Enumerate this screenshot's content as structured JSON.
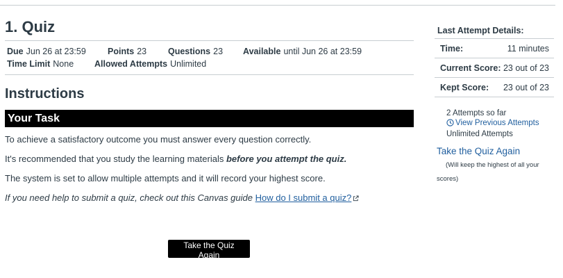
{
  "quiz": {
    "title": "1. Quiz"
  },
  "details": {
    "due_label": "Due",
    "due_value": "Jun 26 at 23:59",
    "points_label": "Points",
    "points_value": "23",
    "questions_label": "Questions",
    "questions_value": "23",
    "available_label": "Available",
    "available_value": "until Jun 26 at 23:59",
    "time_limit_label": "Time Limit",
    "time_limit_value": "None",
    "allowed_attempts_label": "Allowed Attempts",
    "allowed_attempts_value": "Unlimited"
  },
  "instructions": {
    "heading": "Instructions",
    "task_heading": "Your Task",
    "para1": "To achieve a satisfactory outcome you must answer every question correctly.",
    "para2_start": "It's recommended that you study the learning materials ",
    "para2_bold": "before you attempt the quiz.",
    "para3": "The system is set to allow multiple attempts and it will record your highest score.",
    "para4_text": "If you need help to submit a quiz, check out this Canvas guide ",
    "para4_link": "How do I submit a quiz?"
  },
  "buttons": {
    "take_again": "Take the Quiz Again"
  },
  "sidebar": {
    "title": "Last Attempt Details:",
    "rows": [
      {
        "label": "Time:",
        "value": "11 minutes"
      },
      {
        "label": "Current Score:",
        "value": "23 out of 23"
      },
      {
        "label": "Kept Score:",
        "value": "23 out of 23"
      }
    ],
    "attempts_so_far": "2 Attempts so far",
    "view_previous": "View Previous Attempts",
    "unlimited": "Unlimited Attempts",
    "take_again_link": "Take the Quiz Again",
    "keep_note": "(Will keep the highest of all your scores)"
  },
  "colors": {
    "link": "#1f5e9e",
    "text": "#2d3b45",
    "task_bar": "#000000",
    "button": "#000000"
  },
  "icons": {
    "external": "external-link-icon",
    "clock": "clock-icon"
  }
}
